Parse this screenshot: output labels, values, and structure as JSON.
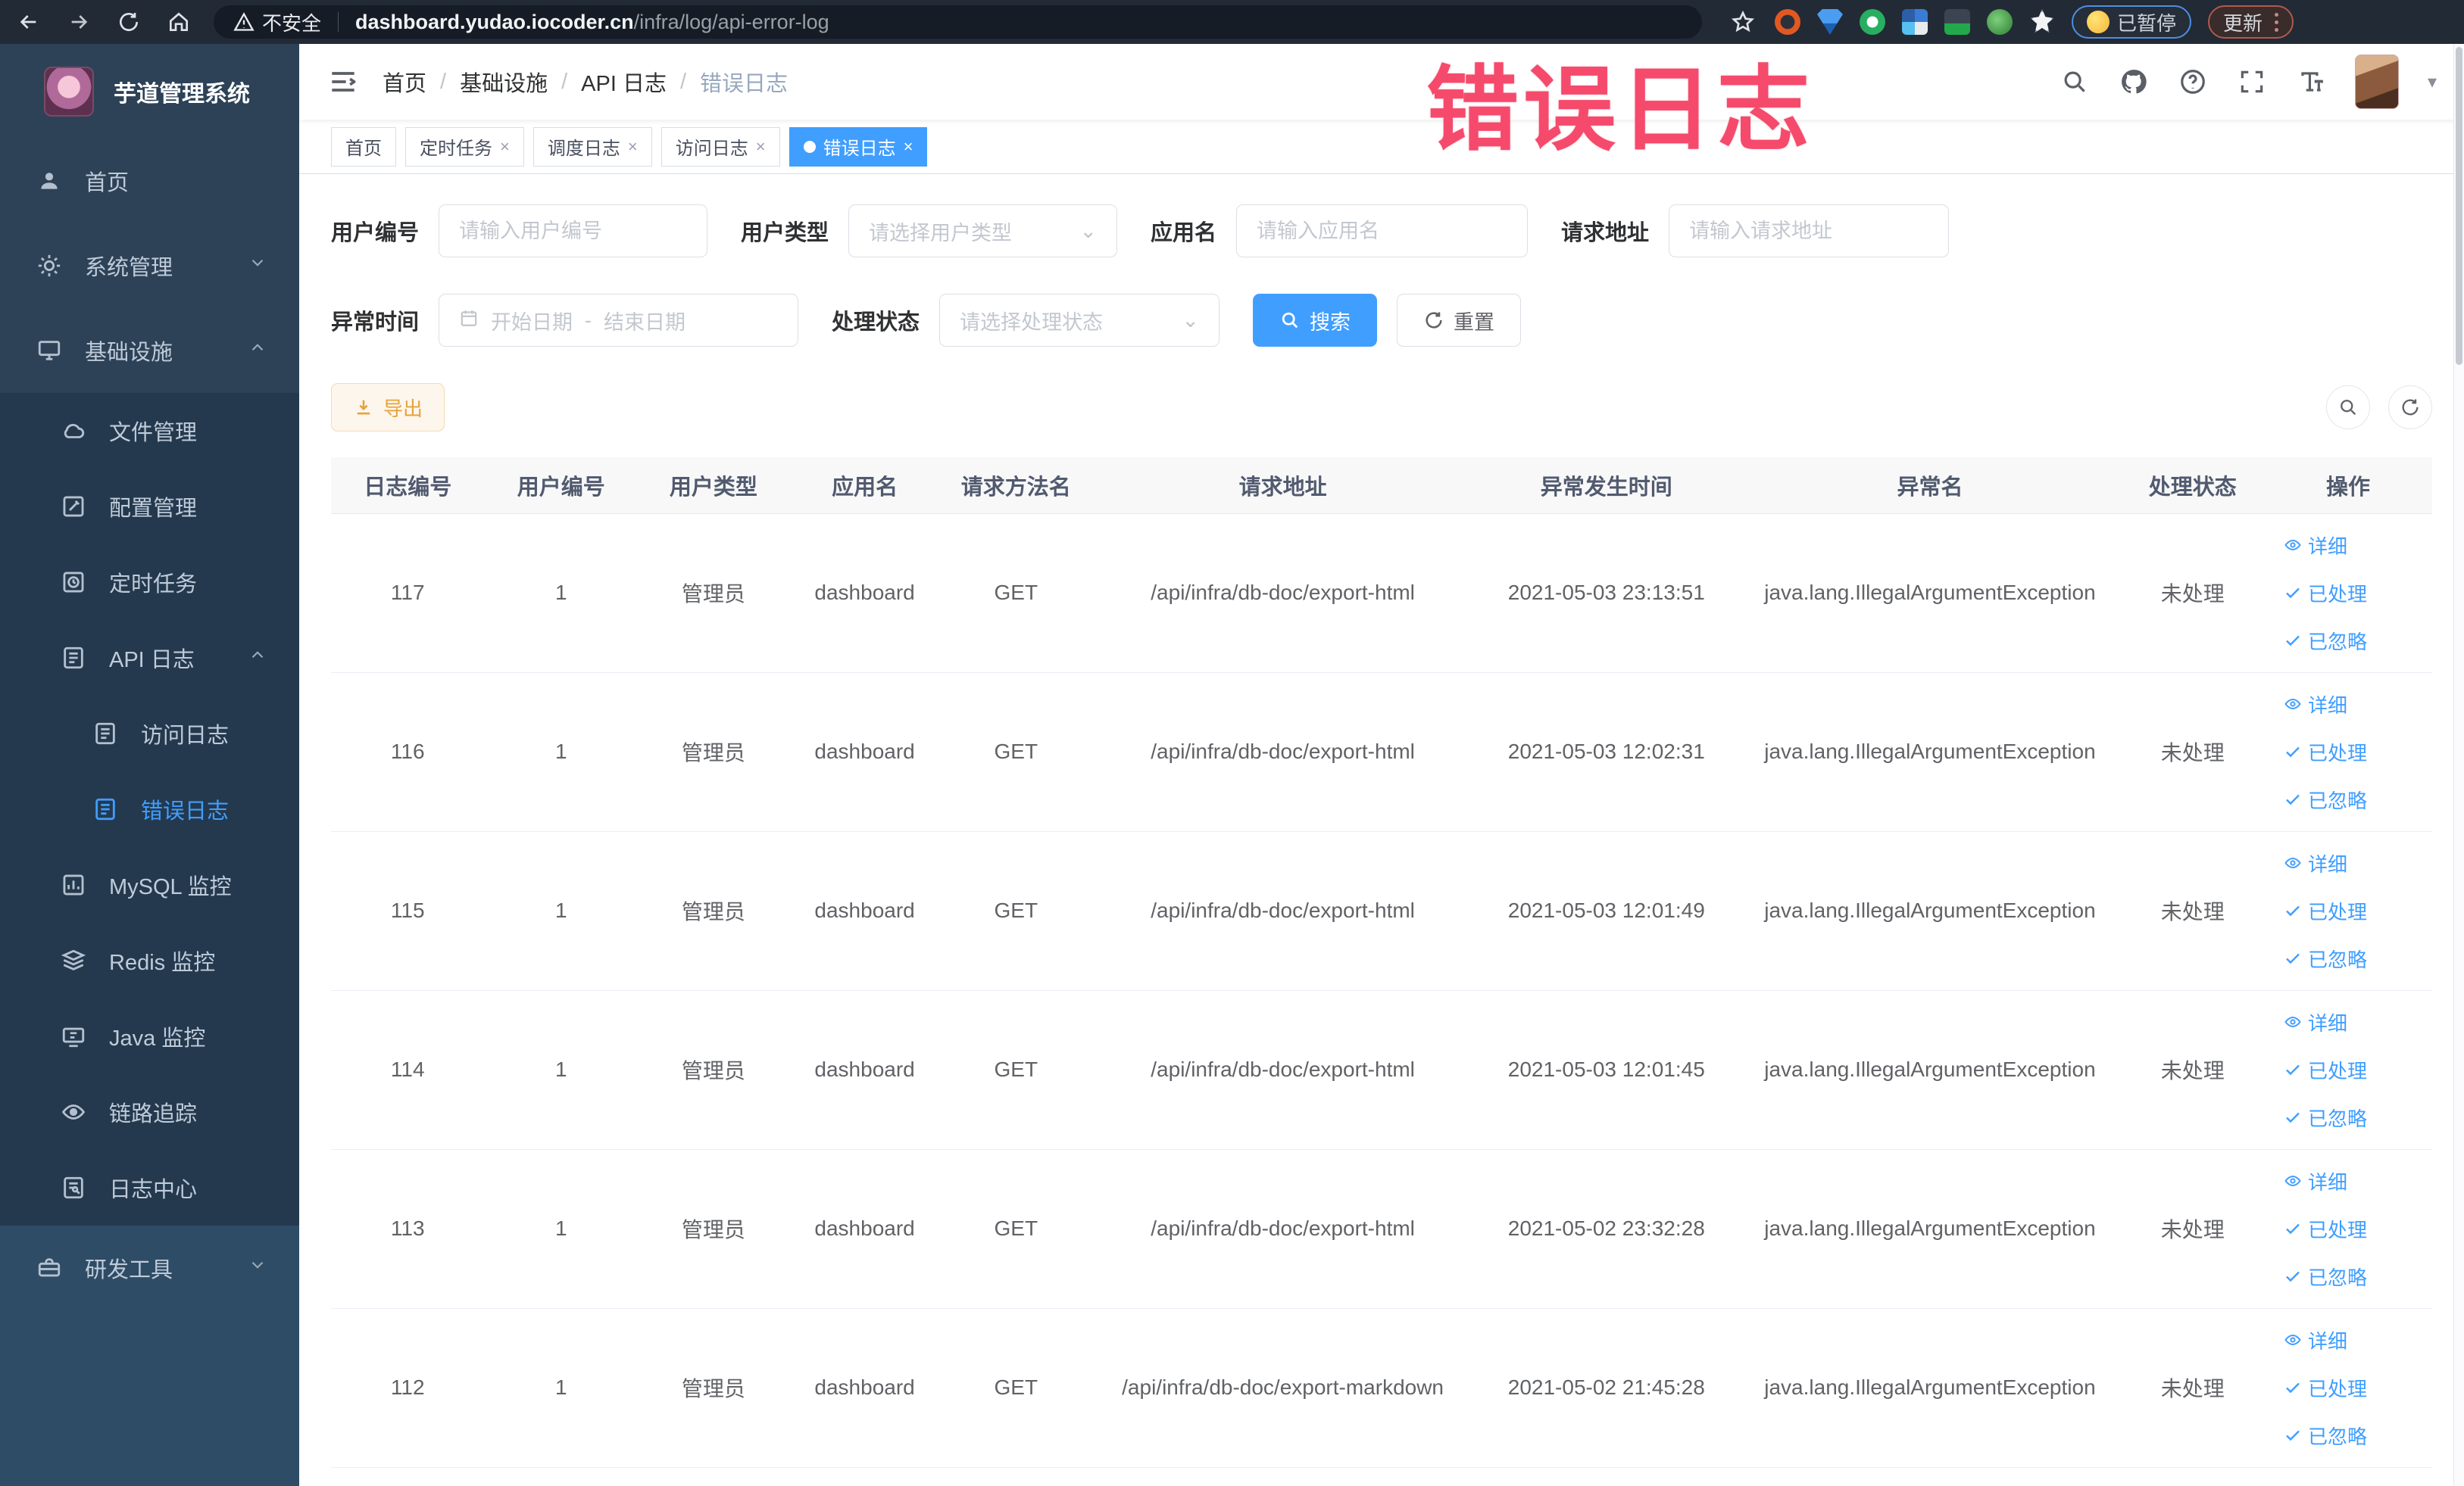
{
  "browser": {
    "security_label": "不安全",
    "url_host": "dashboard.yudao.iocoder.cn",
    "url_path": "/infra/log/api-error-log",
    "paused_badge": "已暂停",
    "update_label": "更新"
  },
  "annotation_text": "错误日志",
  "sidebar": {
    "logo_title": "芋道管理系统",
    "items": {
      "home": "首页",
      "system_mgmt": "系统管理",
      "infrastructure": "基础设施",
      "file_mgmt": "文件管理",
      "config_mgmt": "配置管理",
      "scheduled_jobs": "定时任务",
      "api_log": "API 日志",
      "access_log": "访问日志",
      "error_log": "错误日志",
      "mysql_monitor": "MySQL 监控",
      "redis_monitor": "Redis 监控",
      "java_monitor": "Java 监控",
      "trace": "链路追踪",
      "log_center": "日志中心",
      "dev_tools": "研发工具"
    }
  },
  "navbar": {
    "breadcrumb": [
      "首页",
      "基础设施",
      "API 日志",
      "错误日志"
    ]
  },
  "tabs": {
    "home": "首页",
    "job": "定时任务",
    "job_log": "调度日志",
    "access_log": "访问日志",
    "error_log": "错误日志"
  },
  "filters": {
    "user_id_label": "用户编号",
    "user_id_placeholder": "请输入用户编号",
    "user_type_label": "用户类型",
    "user_type_placeholder": "请选择用户类型",
    "app_name_label": "应用名",
    "app_name_placeholder": "请输入应用名",
    "request_url_label": "请求地址",
    "request_url_placeholder": "请输入请求地址",
    "exception_time_label": "异常时间",
    "start_date_placeholder": "开始日期",
    "range_separator": "-",
    "end_date_placeholder": "结束日期",
    "process_status_label": "处理状态",
    "process_status_placeholder": "请选择处理状态",
    "search_label": "搜索",
    "reset_label": "重置"
  },
  "toolbar": {
    "export_label": "导出"
  },
  "table": {
    "columns": [
      "日志编号",
      "用户编号",
      "用户类型",
      "应用名",
      "请求方法名",
      "请求地址",
      "异常发生时间",
      "异常名",
      "处理状态",
      "操作"
    ],
    "actions": {
      "detail": "详细",
      "processed": "已处理",
      "ignored": "已忽略"
    },
    "rows": [
      {
        "id": "117",
        "user_id": "1",
        "user_type": "管理员",
        "app": "dashboard",
        "method": "GET",
        "url": "/api/infra/db-doc/export-html",
        "time": "2021-05-03 23:13:51",
        "exception": "java.lang.IllegalArgumentException",
        "status": "未处理"
      },
      {
        "id": "116",
        "user_id": "1",
        "user_type": "管理员",
        "app": "dashboard",
        "method": "GET",
        "url": "/api/infra/db-doc/export-html",
        "time": "2021-05-03 12:02:31",
        "exception": "java.lang.IllegalArgumentException",
        "status": "未处理"
      },
      {
        "id": "115",
        "user_id": "1",
        "user_type": "管理员",
        "app": "dashboard",
        "method": "GET",
        "url": "/api/infra/db-doc/export-html",
        "time": "2021-05-03 12:01:49",
        "exception": "java.lang.IllegalArgumentException",
        "status": "未处理"
      },
      {
        "id": "114",
        "user_id": "1",
        "user_type": "管理员",
        "app": "dashboard",
        "method": "GET",
        "url": "/api/infra/db-doc/export-html",
        "time": "2021-05-03 12:01:45",
        "exception": "java.lang.IllegalArgumentException",
        "status": "未处理"
      },
      {
        "id": "113",
        "user_id": "1",
        "user_type": "管理员",
        "app": "dashboard",
        "method": "GET",
        "url": "/api/infra/db-doc/export-html",
        "time": "2021-05-02 23:32:28",
        "exception": "java.lang.IllegalArgumentException",
        "status": "未处理"
      },
      {
        "id": "112",
        "user_id": "1",
        "user_type": "管理员",
        "app": "dashboard",
        "method": "GET",
        "url": "/api/infra/db-doc/export-markdown",
        "time": "2021-05-02 21:45:28",
        "exception": "java.lang.IllegalArgumentException",
        "status": "未处理"
      }
    ]
  },
  "colors": {
    "accent": "#409eff",
    "warning_text": "#e6a23c",
    "annotation": "#f54a6c"
  }
}
